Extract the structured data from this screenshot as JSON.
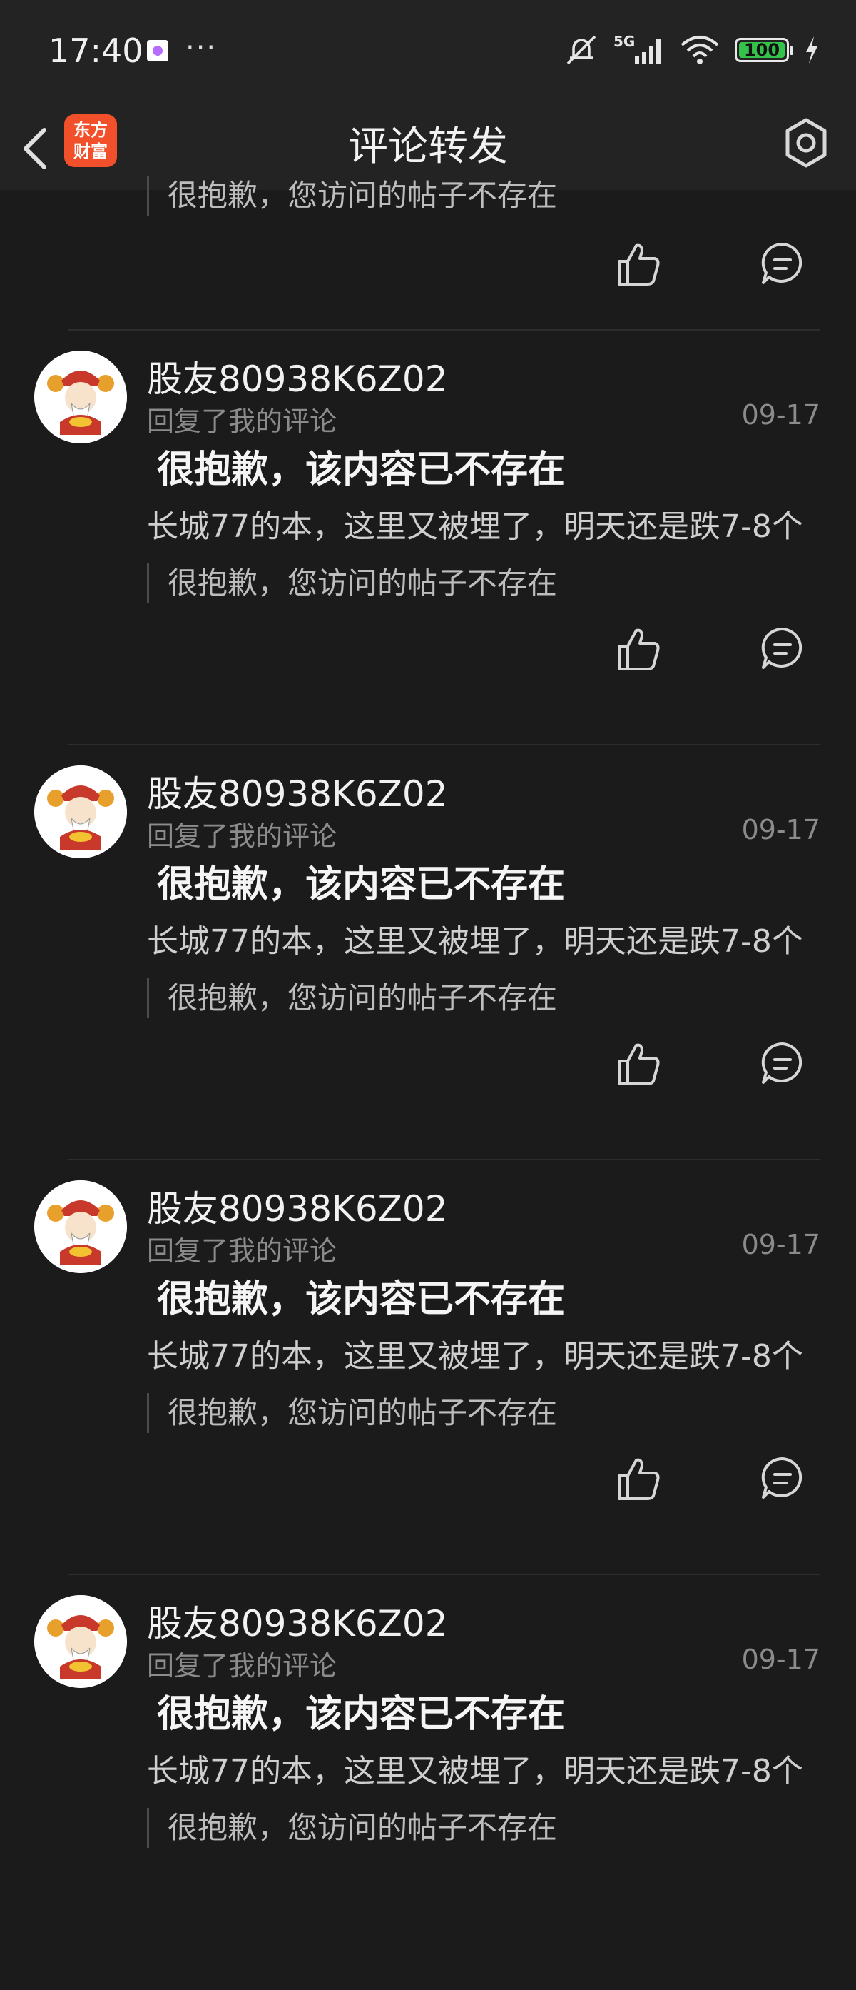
{
  "status_bar": {
    "time": "17:40",
    "more": "···",
    "network": "5G",
    "battery": "100"
  },
  "header": {
    "logo_line1": "东方",
    "logo_line2": "财富",
    "title": "评论转发"
  },
  "partial_top": {
    "quote": "很抱歉，您访问的帖子不存在"
  },
  "items": [
    {
      "name": "股友80938K6Z02",
      "subtitle": "回复了我的评论",
      "date": "09-17",
      "headline": "很抱歉，该内容已不存在",
      "body": "长城77的本，这里又被埋了，明天还是跌7-8个",
      "quote": "很抱歉，您访问的帖子不存在"
    },
    {
      "name": "股友80938K6Z02",
      "subtitle": "回复了我的评论",
      "date": "09-17",
      "headline": "很抱歉，该内容已不存在",
      "body": "长城77的本，这里又被埋了，明天还是跌7-8个",
      "quote": "很抱歉，您访问的帖子不存在"
    },
    {
      "name": "股友80938K6Z02",
      "subtitle": "回复了我的评论",
      "date": "09-17",
      "headline": "很抱歉，该内容已不存在",
      "body": "长城77的本，这里又被埋了，明天还是跌7-8个",
      "quote": "很抱歉，您访问的帖子不存在"
    },
    {
      "name": "股友80938K6Z02",
      "subtitle": "回复了我的评论",
      "date": "09-17",
      "headline": "很抱歉，该内容已不存在",
      "body": "长城77的本，这里又被埋了，明天还是跌7-8个",
      "quote": "很抱歉，您访问的帖子不存在"
    }
  ],
  "colors": {
    "background": "#1b1b1b",
    "logo": "#f1502a",
    "battery": "#35c24b"
  }
}
